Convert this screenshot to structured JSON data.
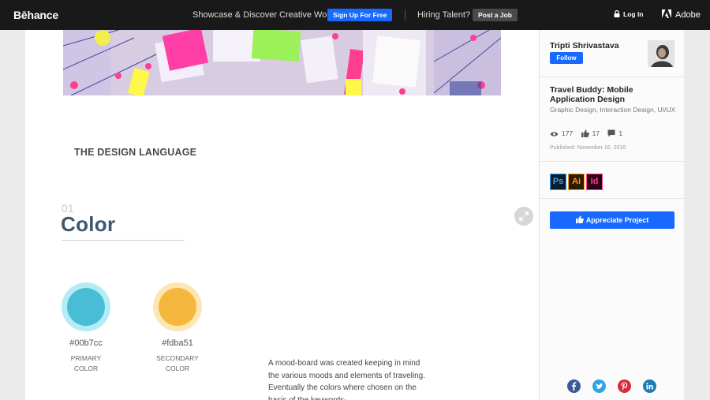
{
  "nav": {
    "logo": "Bēhance",
    "tagline": "Showcase & Discover Creative Work",
    "signup_label": "Sign Up For Free",
    "hiring_label": "Hiring Talent?",
    "post_job_label": "Post a Job",
    "login_label": "Log In",
    "adobe_label": "Adobe"
  },
  "content": {
    "section_heading": "THE DESIGN LANGUAGE",
    "section_number": "01",
    "section_title": "Color",
    "swatches": [
      {
        "hex": "#00b7cc",
        "role_line1": "PRIMARY",
        "role_line2": "COLOR",
        "color": "#49bdd6"
      },
      {
        "hex": "#fdba51",
        "role_line1": "SECONDARY",
        "role_line2": "COLOR",
        "color": "#f5b63d"
      }
    ],
    "description": "A mood-board was created keeping in mind the various moods and elements of traveling. Eventually the colors where chosen on the basis of the keywords-"
  },
  "sidebar": {
    "owner_name": "Tripti Shrivastava",
    "follow_label": "Follow",
    "project_title": "Travel Buddy: Mobile Application Design",
    "project_fields": "Graphic Design, Interaction Design, UI/UX",
    "views": "177",
    "appreciations": "17",
    "comments": "1",
    "published": "Published: November 16, 2016",
    "tools": [
      "Ps",
      "Ai",
      "Id"
    ],
    "appreciate_label": "Appreciate Project",
    "share_icons": [
      "facebook-icon",
      "twitter-icon",
      "pinterest-icon",
      "linkedin-icon"
    ]
  },
  "colors": {
    "brand_blue": "#1769ff",
    "nav_bg": "#191919",
    "title_color": "#3b5872"
  }
}
